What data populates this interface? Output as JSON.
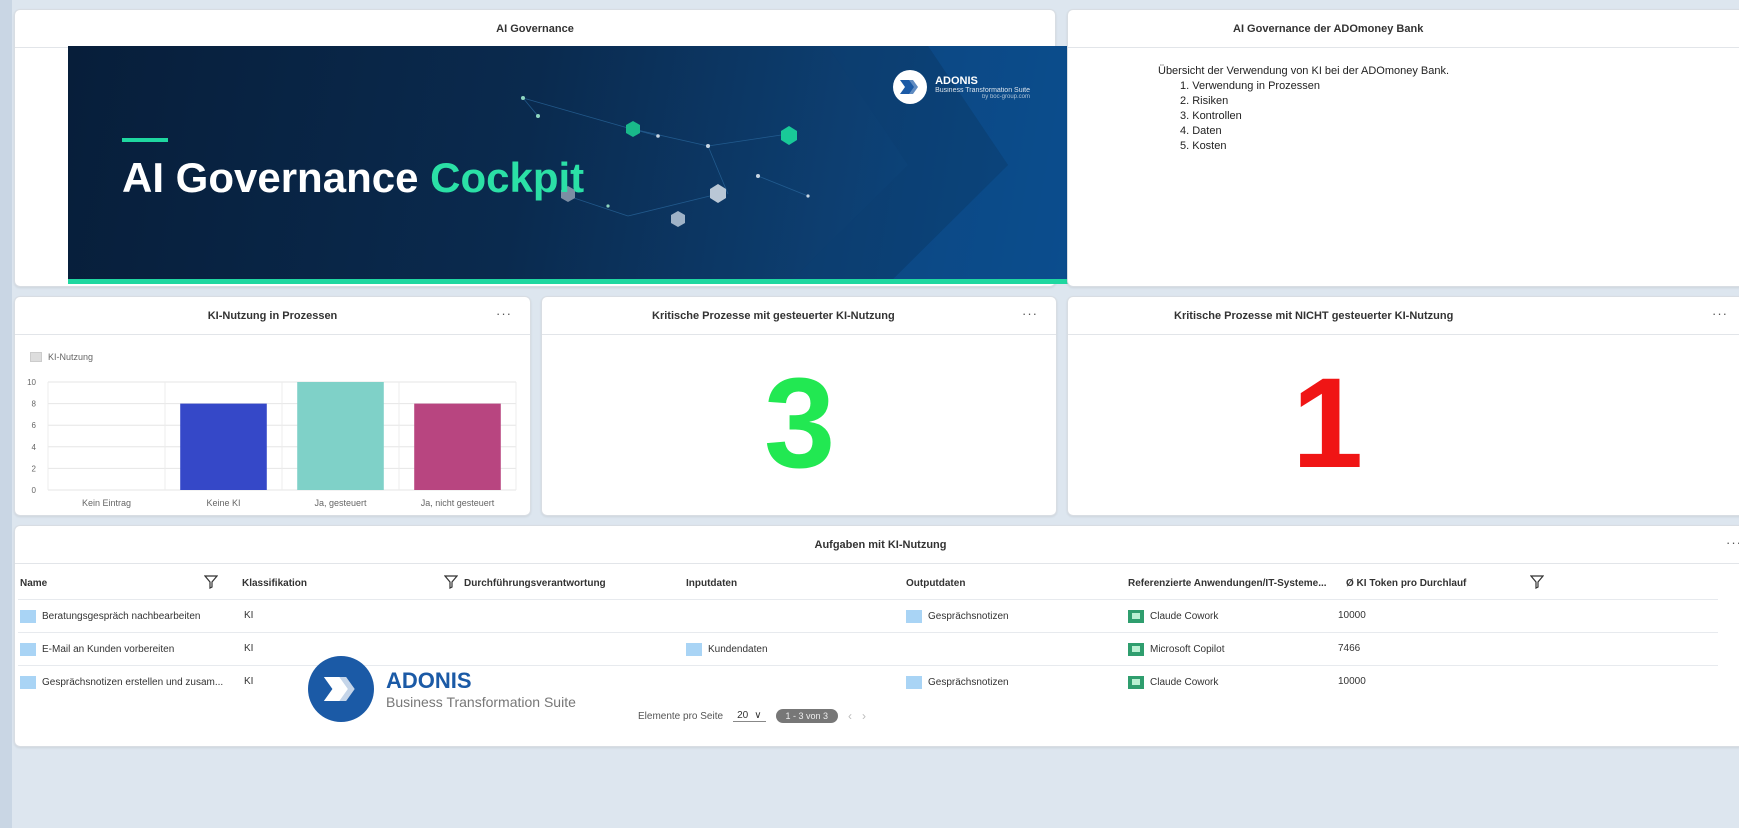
{
  "banner_card": {
    "title": "AI Governance",
    "banner_title_main": "AI Governance",
    "banner_title_highlight": "Cockpit",
    "logo_name": "ADONIS",
    "logo_sub": "Business Transformation Suite",
    "logo_url": "by boc-group.com"
  },
  "info_card": {
    "title": "AI Governance der ADOmoney Bank",
    "intro": "Übersicht der Verwendung von KI bei der ADOmoney Bank.",
    "items": [
      "1. Verwendung in Prozessen",
      "2. Risiken",
      "3. Kontrollen",
      "4. Daten",
      "5. Kosten"
    ]
  },
  "chart_card": {
    "title": "KI-Nutzung in Prozessen",
    "menu": "···"
  },
  "chart_data": {
    "type": "bar",
    "categories": [
      "Kein Eintrag",
      "Keine KI",
      "Ja, gesteuert",
      "Ja, nicht gesteuert"
    ],
    "series": [
      {
        "name": "KI-Nutzung",
        "values": [
          0,
          8,
          10,
          8
        ],
        "colors": [
          "#cccccc",
          "#3548c8",
          "#7fd1c8",
          "#b84580"
        ]
      }
    ],
    "ylim": [
      0,
      10
    ],
    "yticks": [
      "0",
      "2",
      "4",
      "6",
      "8",
      "10"
    ],
    "grid": true,
    "legend": "top-left"
  },
  "kpi_controlled": {
    "title": "Kritische Prozesse mit gesteuerter KI-Nutzung",
    "menu": "···",
    "value": "3",
    "color": "#22e852"
  },
  "kpi_uncontrolled": {
    "title": "Kritische Prozesse mit NICHT gesteuerter KI-Nutzung",
    "menu": "···",
    "value": "1",
    "color": "#f01515"
  },
  "table_card": {
    "title": "Aufgaben mit KI-Nutzung",
    "menu": "···",
    "columns": [
      "Name",
      "Klassifikation",
      "Durchführungsverantwortung",
      "Inputdaten",
      "Outputdaten",
      "Referenzierte Anwendungen/IT-Systeme...",
      "Ø KI Token pro Durchlauf"
    ],
    "rows": [
      {
        "name": "Beratungsgespräch nachbearbeiten",
        "klass": "KI",
        "verantw": "",
        "input": "",
        "output": "Gesprächsnotizen",
        "system": "Claude Cowork",
        "token": "10000"
      },
      {
        "name": "E-Mail an Kunden vorbereiten",
        "klass": "KI",
        "verantw": "",
        "input": "Kundendaten",
        "output": "",
        "system": "Microsoft Copilot",
        "token": "7466"
      },
      {
        "name": "Gesprächsnotizen erstellen und zusam...",
        "klass": "KI",
        "verantw": "",
        "input": "",
        "output": "Gesprächsnotizen",
        "system": "Claude Cowork",
        "token": "10000"
      }
    ],
    "pager": {
      "label": "Elemente pro Seite",
      "page_size": "20",
      "range": "1 - 3 von 3"
    }
  },
  "watermark": {
    "name": "ADONIS",
    "sub": "Business Transformation Suite"
  }
}
